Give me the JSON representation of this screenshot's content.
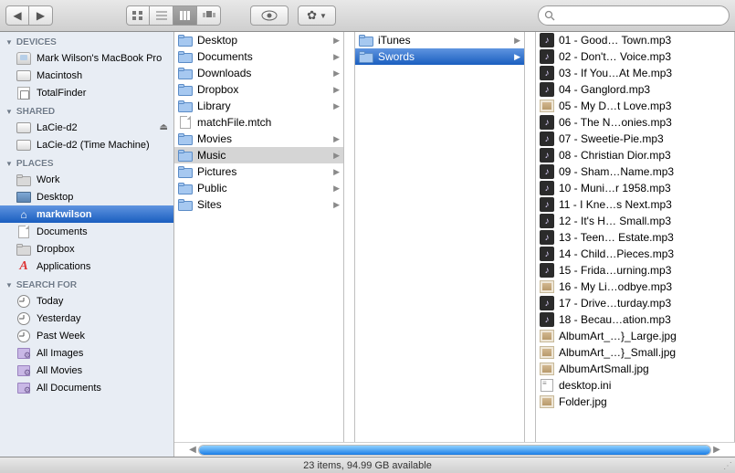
{
  "toolbar": {
    "search_placeholder": ""
  },
  "sidebar": {
    "sections": [
      {
        "title": "DEVICES",
        "items": [
          {
            "label": "Mark Wilson's MacBook Pro",
            "icon": "mac"
          },
          {
            "label": "Macintosh",
            "icon": "drive"
          },
          {
            "label": "TotalFinder",
            "icon": "tf"
          }
        ]
      },
      {
        "title": "SHARED",
        "items": [
          {
            "label": "LaCie-d2",
            "icon": "drive",
            "eject": true
          },
          {
            "label": "LaCie-d2 (Time Machine)",
            "icon": "drive"
          }
        ]
      },
      {
        "title": "PLACES",
        "items": [
          {
            "label": "Work",
            "icon": "folder-grey"
          },
          {
            "label": "Desktop",
            "icon": "desktop"
          },
          {
            "label": "markwilson",
            "icon": "home",
            "selected": true
          },
          {
            "label": "Documents",
            "icon": "file"
          },
          {
            "label": "Dropbox",
            "icon": "folder-grey"
          },
          {
            "label": "Applications",
            "icon": "apps"
          }
        ]
      },
      {
        "title": "SEARCH FOR",
        "items": [
          {
            "label": "Today",
            "icon": "clock"
          },
          {
            "label": "Yesterday",
            "icon": "clock"
          },
          {
            "label": "Past Week",
            "icon": "clock"
          },
          {
            "label": "All Images",
            "icon": "smart"
          },
          {
            "label": "All Movies",
            "icon": "smart"
          },
          {
            "label": "All Documents",
            "icon": "smart"
          }
        ]
      }
    ]
  },
  "columns": {
    "col1": [
      {
        "name": "Desktop",
        "kind": "folder",
        "expand": true
      },
      {
        "name": "Documents",
        "kind": "folder",
        "expand": true
      },
      {
        "name": "Downloads",
        "kind": "folder",
        "expand": true
      },
      {
        "name": "Dropbox",
        "kind": "folder",
        "expand": true
      },
      {
        "name": "Library",
        "kind": "folder",
        "expand": true
      },
      {
        "name": "matchFile.mtch",
        "kind": "file"
      },
      {
        "name": "Movies",
        "kind": "folder",
        "expand": true
      },
      {
        "name": "Music",
        "kind": "folder",
        "expand": true,
        "active": true
      },
      {
        "name": "Pictures",
        "kind": "folder",
        "expand": true
      },
      {
        "name": "Public",
        "kind": "folder",
        "expand": true
      },
      {
        "name": "Sites",
        "kind": "folder",
        "expand": true
      }
    ],
    "col2": [
      {
        "name": "iTunes",
        "kind": "folder",
        "expand": true
      },
      {
        "name": "Swords",
        "kind": "folder",
        "expand": true,
        "selected": true
      }
    ],
    "col3": [
      {
        "name": "01 - Good… Town.mp3",
        "kind": "music"
      },
      {
        "name": "02 - Don't…  Voice.mp3",
        "kind": "music"
      },
      {
        "name": "03 - If You…At Me.mp3",
        "kind": "music"
      },
      {
        "name": "04 - Ganglord.mp3",
        "kind": "music"
      },
      {
        "name": "05 - My D…t Love.mp3",
        "kind": "img"
      },
      {
        "name": "06 - The N…onies.mp3",
        "kind": "music"
      },
      {
        "name": "07 - Sweetie-Pie.mp3",
        "kind": "music"
      },
      {
        "name": "08 - Christian Dior.mp3",
        "kind": "music"
      },
      {
        "name": "09 - Sham…Name.mp3",
        "kind": "music"
      },
      {
        "name": "10 - Muni…r 1958.mp3",
        "kind": "music"
      },
      {
        "name": "11 - I Kne…s Next.mp3",
        "kind": "music"
      },
      {
        "name": "12 - It's H… Small.mp3",
        "kind": "music"
      },
      {
        "name": "13 - Teen… Estate.mp3",
        "kind": "music"
      },
      {
        "name": "14 - Child…Pieces.mp3",
        "kind": "music"
      },
      {
        "name": "15 - Frida…urning.mp3",
        "kind": "music"
      },
      {
        "name": "16 - My Li…odbye.mp3",
        "kind": "img"
      },
      {
        "name": "17 - Drive…turday.mp3",
        "kind": "music"
      },
      {
        "name": "18 - Becau…ation.mp3",
        "kind": "music"
      },
      {
        "name": "AlbumArt_…}_Large.jpg",
        "kind": "img"
      },
      {
        "name": "AlbumArt_…}_Small.jpg",
        "kind": "img"
      },
      {
        "name": "AlbumArtSmall.jpg",
        "kind": "img"
      },
      {
        "name": "desktop.ini",
        "kind": "ini"
      },
      {
        "name": "Folder.jpg",
        "kind": "img"
      }
    ]
  },
  "status": "23 items, 94.99 GB available"
}
